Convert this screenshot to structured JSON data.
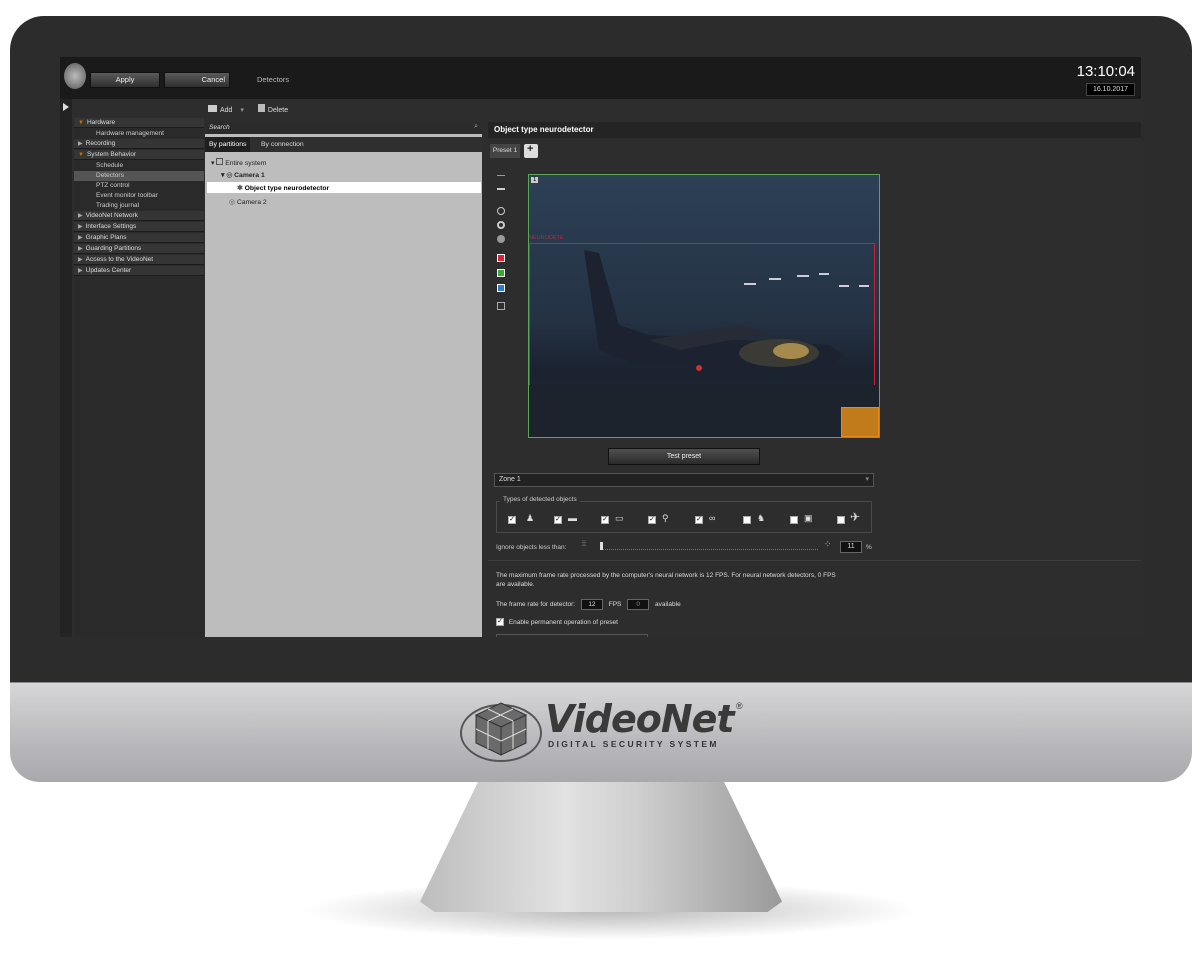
{
  "topbar": {
    "apply": "Apply",
    "cancel": "Cancel",
    "title": "Detectors",
    "time": "13:10:04",
    "date": "16.10.2017"
  },
  "toolbar": {
    "add": "Add",
    "delete": "Delete"
  },
  "nav": {
    "sections": [
      {
        "label": "Hardware",
        "open": true
      },
      {
        "label": "Recording",
        "open": false
      },
      {
        "label": "System Behavior",
        "open": true
      },
      {
        "label": "VideoNet Network",
        "open": false
      },
      {
        "label": "Interface Settings",
        "open": false
      },
      {
        "label": "Graphic Plans",
        "open": false
      },
      {
        "label": "Guarding Partitions",
        "open": false
      },
      {
        "label": "Access to the VideoNet",
        "open": false
      },
      {
        "label": "Updates Center",
        "open": false
      }
    ],
    "hardware_sub": [
      "Hardware management"
    ],
    "behavior_sub": [
      "Schedule",
      "Detectors",
      "PTZ control",
      "Event monitor toolbar",
      "Trading journal"
    ]
  },
  "tree": {
    "search": "Search",
    "tab1": "By partitions",
    "tab2": "By connection",
    "root": "Entire system",
    "camera1": "Camera 1",
    "detector": "Object type neurodetector",
    "camera2": "Camera 2"
  },
  "panel": {
    "title": "Object type neurodetector",
    "preset": "Preset 1",
    "video_index": "1",
    "zone_label": "NEURODETE",
    "test_button": "Test preset",
    "zone": "Zone 1",
    "types_label": "Types of detected objects",
    "objects": [
      {
        "icon": "person-icon",
        "checked": true
      },
      {
        "icon": "car-icon",
        "checked": true
      },
      {
        "icon": "bus-icon",
        "checked": true
      },
      {
        "icon": "motorcycle-icon",
        "checked": true
      },
      {
        "icon": "bicycle-icon",
        "checked": true
      },
      {
        "icon": "dog-icon",
        "checked": false
      },
      {
        "icon": "train-icon",
        "checked": false
      },
      {
        "icon": "airplane-icon",
        "checked": false
      }
    ],
    "ignore_label": "Ignore objects less than:",
    "ignore_value": "11",
    "ignore_unit": "%",
    "info1": "The maximum frame rate processed by the computer's neural network is 12 FPS. For neural network detectors, 0 FPS are available.",
    "fps_label": "The frame rate for detector:",
    "fps_value": "12",
    "fps_unit": "FPS",
    "avail_value": "0",
    "avail_label": "available",
    "permanent": "Enable permanent operation of preset"
  },
  "brand": {
    "name": "VideoNet",
    "reg": "®",
    "tagline": "DIGITAL SECURITY SYSTEM"
  }
}
